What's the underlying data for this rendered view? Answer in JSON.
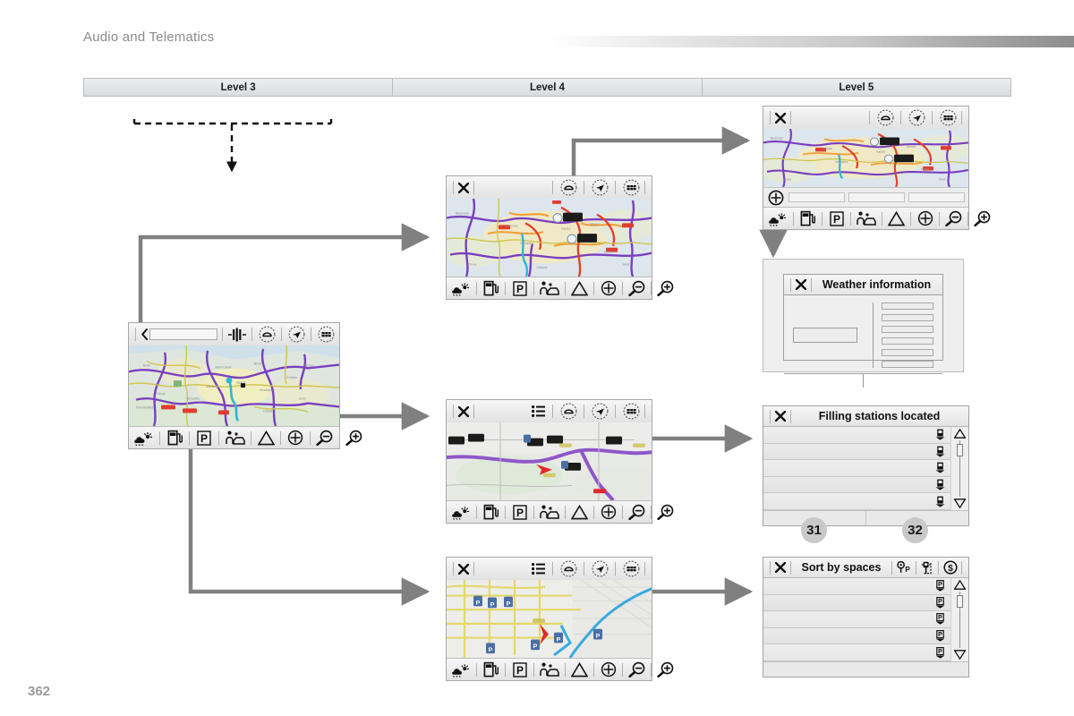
{
  "header": {
    "title": "Audio and Telematics",
    "gradient_from": "#ffffff",
    "gradient_to": "#8e8e8e"
  },
  "page_number": "362",
  "columns": [
    {
      "label": "Level 3"
    },
    {
      "label": "Level 4"
    },
    {
      "label": "Level 5"
    }
  ],
  "screens": {
    "nav_map": {
      "name": "navigation-map-screen",
      "topbar_icons": [
        "back-chevron-icon",
        "search-field",
        "traffic-bars-icon",
        "reroute-icon",
        "navigation-arrow-icon",
        "map-grid-icon"
      ],
      "bottom_icons": [
        "weather-icon",
        "fuel-pump-icon",
        "parking-icon",
        "services-icon",
        "warning-triangle-icon",
        "target-plus-icon",
        "zoom-out-icon",
        "zoom-in-icon"
      ]
    },
    "traffic_map_l4": {
      "name": "traffic-map-screen-level4",
      "topbar_icons": [
        "close-icon",
        "reroute-icon",
        "navigation-arrow-icon",
        "map-grid-icon"
      ],
      "bottom_icons": [
        "weather-icon",
        "fuel-pump-icon",
        "parking-icon",
        "services-icon",
        "warning-triangle-icon",
        "target-plus-icon",
        "zoom-out-icon",
        "zoom-in-icon"
      ]
    },
    "traffic_map_l5": {
      "name": "traffic-map-screen-level5",
      "topbar_icons": [
        "close-icon",
        "reroute-icon",
        "navigation-arrow-icon",
        "map-grid-icon"
      ],
      "midrow_icon": "add-plus-icon",
      "midrow_fields": [
        "",
        "",
        ""
      ],
      "bottom_icons": [
        "weather-icon",
        "fuel-pump-icon",
        "parking-icon",
        "services-icon",
        "warning-triangle-icon",
        "target-plus-icon",
        "zoom-out-icon",
        "zoom-in-icon"
      ]
    },
    "fuel_map_l4": {
      "name": "filling-station-map-screen",
      "topbar_icons": [
        "close-icon",
        "list-icon",
        "reroute-icon",
        "navigation-arrow-icon",
        "map-grid-icon"
      ],
      "bottom_icons": [
        "weather-icon",
        "fuel-pump-icon",
        "parking-icon",
        "services-icon",
        "warning-triangle-icon",
        "target-plus-icon",
        "zoom-out-icon",
        "zoom-in-icon"
      ]
    },
    "parking_map_l4": {
      "name": "parking-map-screen",
      "topbar_icons": [
        "close-icon",
        "list-icon",
        "reroute-icon",
        "navigation-arrow-icon",
        "map-grid-icon"
      ],
      "bottom_icons": [
        "weather-icon",
        "fuel-pump-icon",
        "parking-icon",
        "services-icon",
        "warning-triangle-icon",
        "target-plus-icon",
        "zoom-out-icon",
        "zoom-in-icon"
      ]
    }
  },
  "weather_panel": {
    "name": "weather-information-panel",
    "close_icon": "close-icon",
    "title": "Weather information",
    "line_count": 6
  },
  "filling_panel": {
    "name": "filling-stations-located-panel",
    "close_icon": "close-icon",
    "title": "Filling stations located",
    "row_icon": "fuel-pin-icon",
    "row_count": 5,
    "scroll_up_icon": "triangle-up-icon",
    "scroll_down_icon": "triangle-down-icon"
  },
  "sort_panel": {
    "name": "sort-by-spaces-panel",
    "close_icon": "close-icon",
    "title": "Sort by spaces",
    "header_icons": [
      "parking-pin-icon",
      "parking-meter-icon",
      "price-dollar-icon"
    ],
    "row_icon": "parking-pin-icon",
    "row_count": 5,
    "scroll_up_icon": "triangle-up-icon",
    "scroll_down_icon": "triangle-down-icon"
  },
  "badges": [
    {
      "name": "callout-badge-31",
      "label": "31"
    },
    {
      "name": "callout-badge-32",
      "label": "32"
    }
  ],
  "connectors": {
    "color": "#808080",
    "dashed_color": "#111111"
  }
}
